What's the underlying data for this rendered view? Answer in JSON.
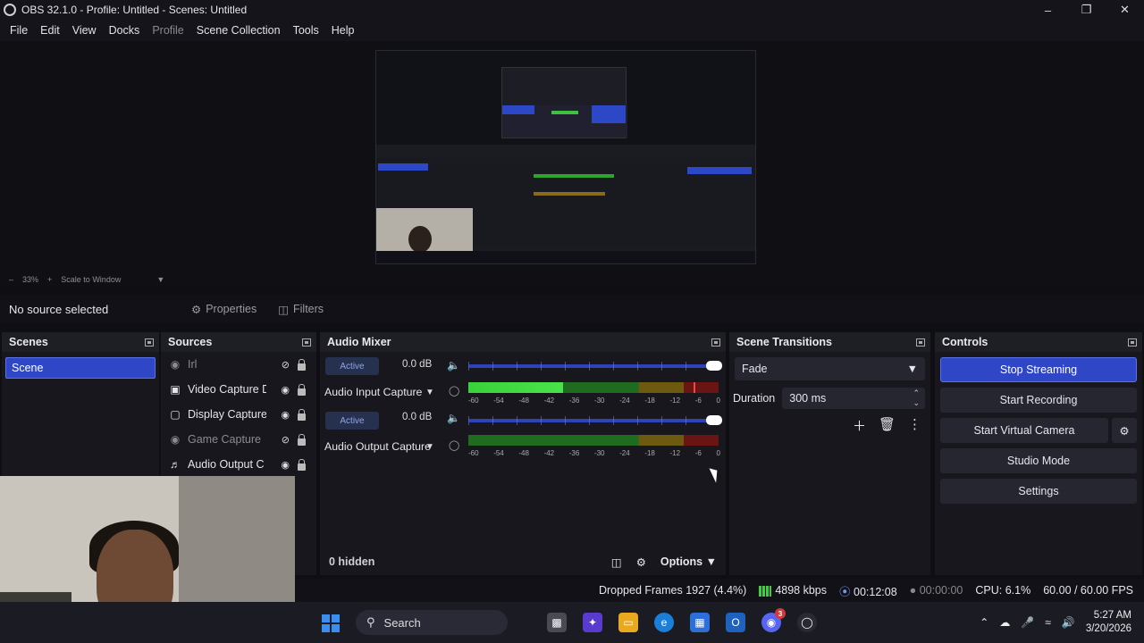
{
  "window": {
    "title": "OBS 32.1.0 - Profile: Untitled - Scenes: Untitled"
  },
  "menu": [
    "File",
    "Edit",
    "View",
    "Docks",
    "Profile",
    "Scene Collection",
    "Tools",
    "Help"
  ],
  "zoom": {
    "level": "33%",
    "mode": "Scale to Window"
  },
  "context": {
    "no_source": "No source selected",
    "properties": "Properties",
    "filters": "Filters"
  },
  "scenes": {
    "title": "Scenes",
    "items": [
      "Scene"
    ]
  },
  "sources": {
    "title": "Sources",
    "items": [
      {
        "name": "Irl",
        "icon": "camera-off-icon",
        "visible": false
      },
      {
        "name": "Video Capture D",
        "icon": "camera-icon",
        "visible": true
      },
      {
        "name": "Display Capture",
        "icon": "monitor-icon",
        "visible": true
      },
      {
        "name": "Game Capture",
        "icon": "gamepad-icon",
        "visible": false
      },
      {
        "name": "Audio Output C",
        "icon": "speaker-icon",
        "visible": true
      }
    ]
  },
  "mixer": {
    "title": "Audio Mixer",
    "channels": [
      {
        "name": "Audio Input Capture",
        "active": "Active",
        "db": "0.0 dB",
        "level": 0.38
      },
      {
        "name": "Audio Output Capture",
        "active": "Active",
        "db": "0.0 dB",
        "level": 0.0
      }
    ],
    "scale": [
      "-60",
      "-54",
      "-48",
      "-42",
      "-36",
      "-30",
      "-24",
      "-18",
      "-12",
      "-6",
      "0"
    ],
    "hidden": "0 hidden",
    "options": "Options"
  },
  "transitions": {
    "title": "Scene Transitions",
    "selected": "Fade",
    "duration_label": "Duration",
    "duration_value": "300 ms"
  },
  "controls": {
    "title": "Controls",
    "stop_streaming": "Stop Streaming",
    "start_recording": "Start Recording",
    "start_virtual_camera": "Start Virtual Camera",
    "studio_mode": "Studio Mode",
    "settings": "Settings"
  },
  "status": {
    "dropped_frames": "Dropped Frames 1927 (4.4%)",
    "bitrate": "4898 kbps",
    "stream_time": "00:12:08",
    "record_time": "00:00:00",
    "cpu": "CPU: 6.1%",
    "fps": "60.00 / 60.00 FPS"
  },
  "taskbar": {
    "search": "Search",
    "time": "5:27 AM",
    "date": "3/20/2026",
    "notification_count": "3"
  },
  "colors": {
    "accent": "#2f47c6",
    "bg": "#0f0f13",
    "panel": "#17171d"
  }
}
